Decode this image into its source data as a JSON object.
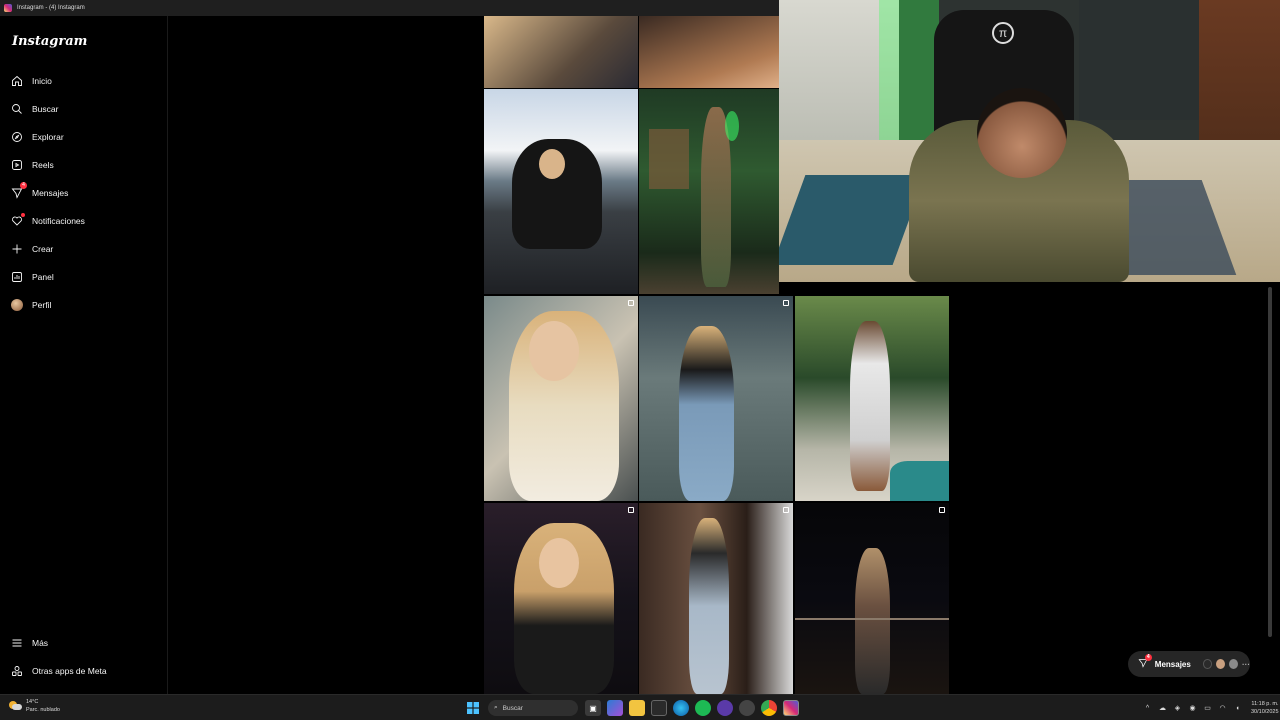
{
  "window": {
    "title": "Instagram - (4) Instagram"
  },
  "sidebar": {
    "logo": "Instagram",
    "items": [
      {
        "label": "Inicio",
        "icon": "home-icon"
      },
      {
        "label": "Buscar",
        "icon": "search-icon"
      },
      {
        "label": "Explorar",
        "icon": "compass-icon"
      },
      {
        "label": "Reels",
        "icon": "reels-icon"
      },
      {
        "label": "Mensajes",
        "icon": "messenger-icon",
        "badge": "4"
      },
      {
        "label": "Notificaciones",
        "icon": "heart-icon"
      },
      {
        "label": "Crear",
        "icon": "plus-icon"
      },
      {
        "label": "Panel",
        "icon": "dashboard-icon"
      },
      {
        "label": "Perfil",
        "icon": "avatar-icon"
      }
    ],
    "bottom": [
      {
        "label": "Más",
        "icon": "menu-icon"
      },
      {
        "label": "Otras apps de Meta",
        "icon": "meta-apps-icon"
      }
    ]
  },
  "messages_pill": {
    "label": "Mensajes",
    "badge": "4"
  },
  "taskbar": {
    "weather_temp": "14°C",
    "weather_desc": "Parc. nublado",
    "search_placeholder": "Buscar",
    "time": "11:18 p. m.",
    "date": "30/10/2025"
  },
  "colors": {
    "accent_red": "#ff3040",
    "background": "#000000",
    "taskbar": "#1c1c1c"
  }
}
